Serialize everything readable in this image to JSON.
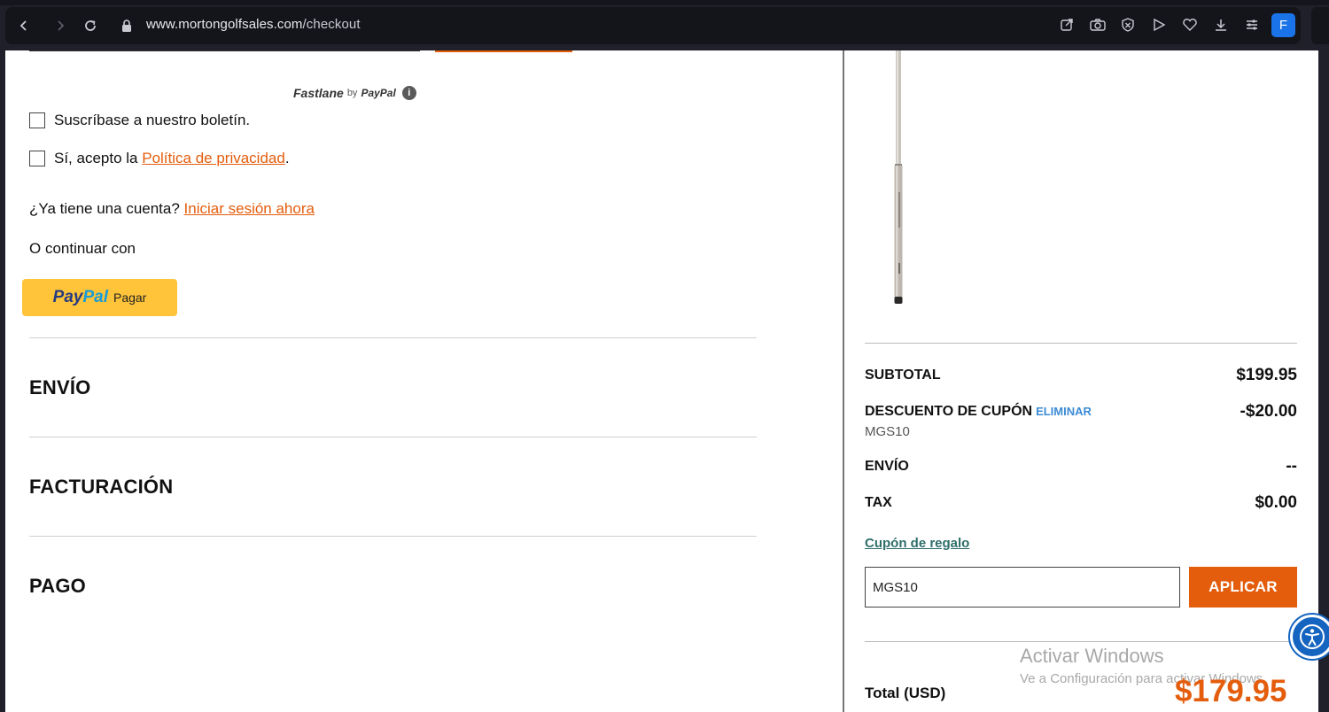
{
  "browser": {
    "url_host": "www.mortongolfsales.com",
    "url_path": "/checkout",
    "profile_initial": "F"
  },
  "checkout": {
    "fastlane_brand": "Fastlane",
    "fastlane_by": "by",
    "fastlane_paypal": "PayPal",
    "newsletter_label": "Suscríbase a nuestro boletín.",
    "privacy_prefix": "Sí, acepto la ",
    "privacy_link": "Política de privacidad",
    "privacy_suffix": ".",
    "account_question": "¿Ya tiene una cuenta? ",
    "login_link": "Iniciar sesión ahora",
    "continue_with": "O continuar con",
    "paypal_pay": "PayPal",
    "paypal_pay_p1": "Pay",
    "paypal_pay_p2": "Pal",
    "paypal_pagar": "Pagar",
    "sections": [
      "ENVÍO",
      "FACTURACIÓN",
      "PAGO"
    ]
  },
  "summary": {
    "subtotal_label": "SUBTOTAL",
    "subtotal_value": "$199.95",
    "coupon_label": "DESCUENTO DE CUPÓN",
    "coupon_remove": "ELIMINAR",
    "coupon_value": "-$20.00",
    "coupon_code": "MGS10",
    "shipping_label": "ENVÍO",
    "shipping_value": "--",
    "tax_label": "TAX",
    "tax_value": "$0.00",
    "gift_link": "Cupón de regalo",
    "coupon_input_value": "MGS10",
    "apply_button": "APLICAR",
    "total_label": "Total (USD)",
    "total_value": "$179.95"
  },
  "watermark": {
    "line1": "Activar Windows",
    "line2": "Ve a Configuración para activar Windows."
  },
  "colors": {
    "accent": "#e35d0d",
    "paypal_yellow": "#ffc439",
    "link_teal": "#2e6f6a",
    "eliminar_blue": "#3b8bd4"
  },
  "icons": [
    "back-icon",
    "forward-icon",
    "reload-icon",
    "lock-icon",
    "share-icon",
    "camera-icon",
    "shield-icon",
    "play-icon",
    "heart-icon",
    "download-icon",
    "menu-icon",
    "info-icon",
    "accessibility-icon"
  ]
}
